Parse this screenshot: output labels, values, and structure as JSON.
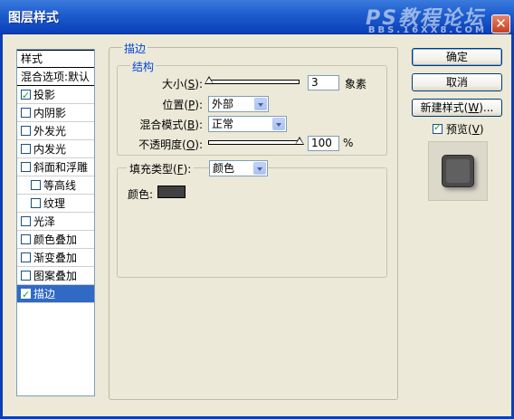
{
  "window": {
    "title": "图层样式",
    "watermark_top": "PS教程论坛",
    "watermark_bottom": "BBS.16XX8.COM",
    "close_glyph": "✕"
  },
  "stylelist": {
    "header": "样式",
    "items": [
      {
        "label": "混合选项:默认",
        "checkbox": false,
        "checked": false,
        "indent": false,
        "selected": false
      },
      {
        "label": "投影",
        "checkbox": true,
        "checked": true,
        "indent": false,
        "selected": false
      },
      {
        "label": "内阴影",
        "checkbox": true,
        "checked": false,
        "indent": false,
        "selected": false
      },
      {
        "label": "外发光",
        "checkbox": true,
        "checked": false,
        "indent": false,
        "selected": false
      },
      {
        "label": "内发光",
        "checkbox": true,
        "checked": false,
        "indent": false,
        "selected": false
      },
      {
        "label": "斜面和浮雕",
        "checkbox": true,
        "checked": false,
        "indent": false,
        "selected": false
      },
      {
        "label": "等高线",
        "checkbox": true,
        "checked": false,
        "indent": true,
        "selected": false
      },
      {
        "label": "纹理",
        "checkbox": true,
        "checked": false,
        "indent": true,
        "selected": false
      },
      {
        "label": "光泽",
        "checkbox": true,
        "checked": false,
        "indent": false,
        "selected": false
      },
      {
        "label": "颜色叠加",
        "checkbox": true,
        "checked": false,
        "indent": false,
        "selected": false
      },
      {
        "label": "渐变叠加",
        "checkbox": true,
        "checked": false,
        "indent": false,
        "selected": false
      },
      {
        "label": "图案叠加",
        "checkbox": true,
        "checked": false,
        "indent": false,
        "selected": false
      },
      {
        "label": "描边",
        "checkbox": true,
        "checked": true,
        "indent": false,
        "selected": true
      }
    ]
  },
  "stroke": {
    "section_title": "描边",
    "structure_title": "结构",
    "size_label": "大小(",
    "size_key": "S",
    "size_value": "3",
    "size_unit": "象素",
    "position_label": "位置(",
    "position_key": "P",
    "position_value": "外部",
    "blend_label": "混合模式(",
    "blend_key": "B",
    "blend_value": "正常",
    "opacity_label": "不透明度(",
    "opacity_key": "O",
    "opacity_value": "100",
    "opacity_unit": "%",
    "fill_type_label": "填充类型(",
    "fill_type_key": "F",
    "fill_type_value": "颜色",
    "color_label": "颜色:",
    "color_value": "#404040"
  },
  "buttons": {
    "ok": "确定",
    "cancel": "取消",
    "new_style": "新建样式(",
    "new_style_key": "W",
    "new_style_suffix": ")...",
    "preview_label": "预览(",
    "preview_key": "V",
    "preview_checked": true
  }
}
